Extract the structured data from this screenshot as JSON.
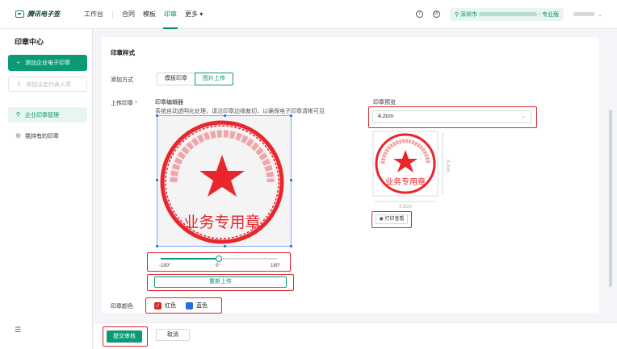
{
  "header": {
    "logo_text": "腾讯电子签",
    "nav": [
      "工作台",
      "合同",
      "模板",
      "印章",
      "更多"
    ],
    "active_nav": "印章",
    "org_prefix": "深圳市",
    "org_suffix": "- 专业版"
  },
  "sidebar": {
    "title": "印章中心",
    "add_enterprise_seal": "添加企业电子印章",
    "add_legal_rep": "添加法定代表人章",
    "items": [
      {
        "label": "企业印章管理",
        "icon": "seal-icon",
        "active": true
      },
      {
        "label": "我持有的印章",
        "icon": "target-icon",
        "active": false
      }
    ]
  },
  "form": {
    "section_title": "印章样式",
    "add_method_label": "添加方式",
    "add_methods": [
      "模板印章",
      "图片上传"
    ],
    "active_method": "图片上传",
    "upload_label": "上传印章",
    "required_mark": "*",
    "editor_title": "印章编辑器",
    "editor_hint": "系统自动透明化处理，请沿印章边缘裁切，以确保电子印章清晰可见",
    "rotation": {
      "min": "-180°",
      "mid": "0°",
      "max": "180°",
      "value": 0
    },
    "reupload_label": "重新上传",
    "color_label": "印章颜色",
    "colors": [
      {
        "label": "红色",
        "hex": "#d9272e",
        "checked": true
      },
      {
        "label": "蓝色",
        "hex": "#1e6fe0",
        "checked": false
      }
    ],
    "preview_title": "印章预览",
    "size_value": "4.2cm",
    "size_dim": "4.2cm",
    "print_label": "打印查看"
  },
  "seal": {
    "bottom_text": "业务专用章",
    "color": "#e8262c"
  },
  "footer": {
    "submit_label": "提交审核",
    "cancel_label": "取消"
  }
}
